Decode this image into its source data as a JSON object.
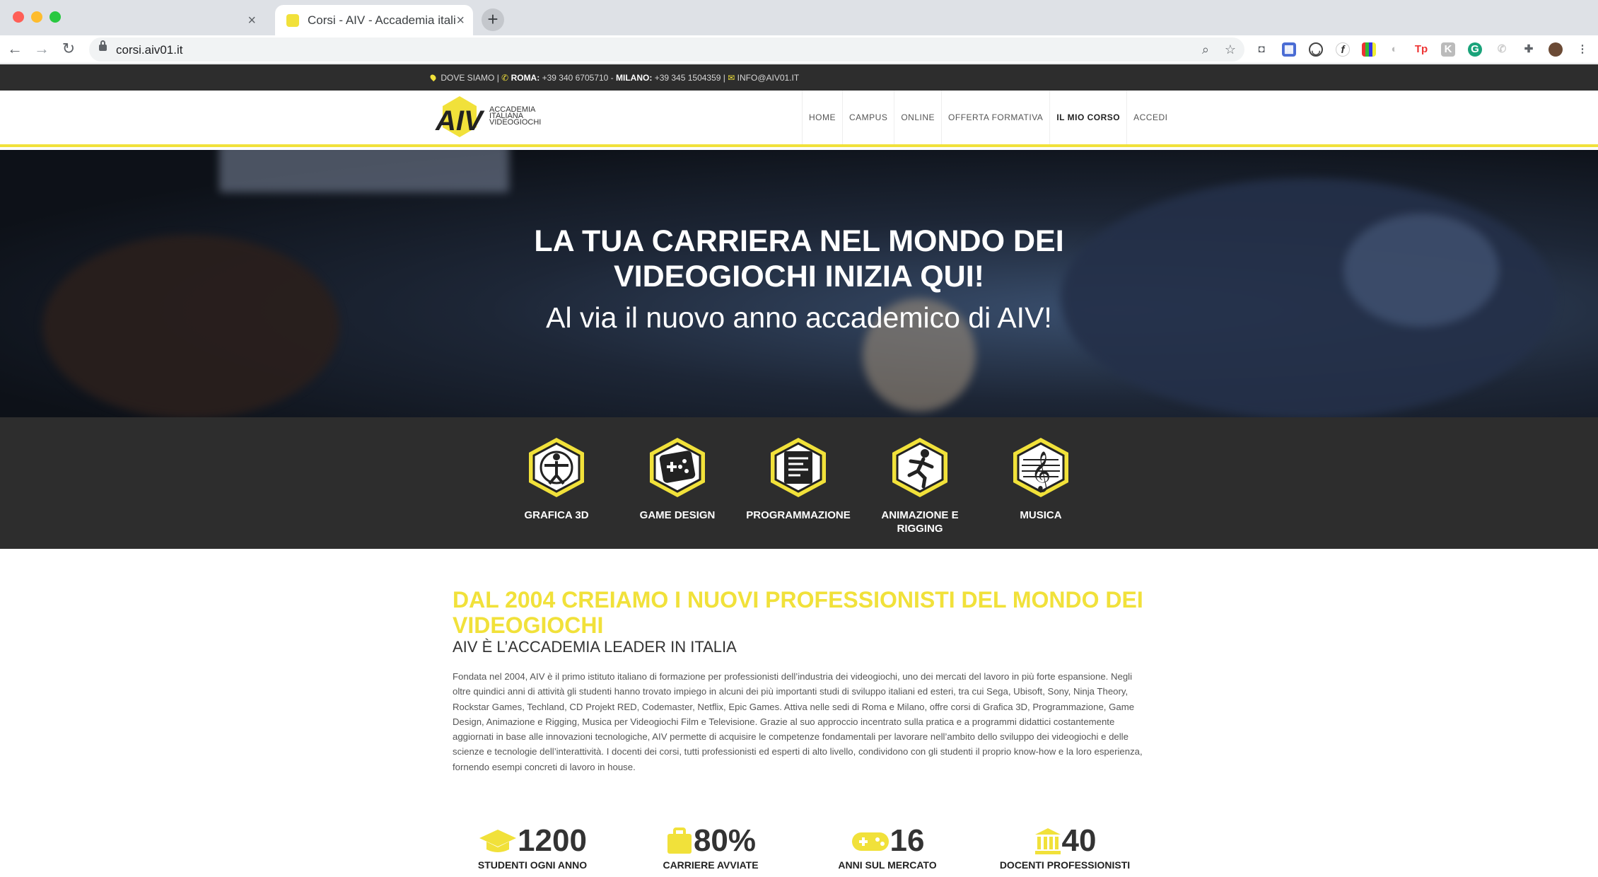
{
  "browser": {
    "tab_title": "Corsi - AIV - Accademia italiana videogiochi",
    "url": "corsi.aiv01.it"
  },
  "topbar": {
    "dove": "DOVE SIAMO",
    "roma_label": "ROMA:",
    "roma_phone": "+39 340 6705710",
    "milano_label": "MILANO:",
    "milano_phone": "+39 345 1504359",
    "email": "INFO@AIV01.IT"
  },
  "logo": {
    "lines": [
      "ACCADEMIA",
      "ITALIANA",
      "VIDEOGIOCHI"
    ]
  },
  "nav": [
    "HOME",
    "CAMPUS",
    "ONLINE",
    "OFFERTA FORMATIVA",
    "IL MIO CORSO",
    "ACCEDI"
  ],
  "hero": {
    "title_line1": "LA TUA CARRIERA NEL MONDO DEI",
    "title_line2": "VIDEOGIOCHI INIZIA QUI!",
    "subtitle": "Al via il nuovo anno accademico di AIV!"
  },
  "courses": [
    {
      "label": "GRAFICA 3D",
      "icon": "vitruvian-icon"
    },
    {
      "label": "GAME DESIGN",
      "icon": "dice-icon"
    },
    {
      "label": "PROGRAMMAZIONE",
      "icon": "code-sheet-icon"
    },
    {
      "label": "ANIMAZIONE E RIGGING",
      "icon": "running-figure-icon"
    },
    {
      "label": "MUSICA",
      "icon": "treble-clef-icon"
    }
  ],
  "content": {
    "headline": "DAL 2004 CREIAMO I NUOVI PROFESSIONISTI DEL MONDO DEI VIDEOGIOCHI",
    "subhead": "AIV È L’ACCADEMIA LEADER IN ITALIA",
    "body": "Fondata nel 2004, AIV è il primo istituto italiano di formazione per professionisti dell’industria dei videogiochi, uno dei mercati del lavoro in più forte espansione. Negli oltre quindici anni di attività gli studenti hanno trovato impiego in alcuni dei più importanti studi di sviluppo italiani ed esteri, tra cui Sega, Ubisoft, Sony, Ninja Theory, Rockstar Games, Techland, CD Projekt RED, Codemaster, Netflix, Epic Games. Attiva nelle sedi di Roma e Milano, offre corsi di Grafica 3D, Programmazione, Game Design, Animazione e Rigging, Musica per Videogiochi Film e Televisione. Grazie al suo approccio incentrato sulla pratica e a programmi didattici costantemente aggiornati in base alle innovazioni tecnologiche, AIV permette di acquisire le competenze fondamentali per lavorare nell’ambito dello sviluppo dei videogiochi e delle scienze e tecnologie dell’interattività. I docenti dei corsi, tutti professionisti ed esperti di alto livello, condividono con gli studenti il proprio know-how e la loro esperienza, fornendo esempi concreti di lavoro in house."
  },
  "stats": [
    {
      "value": "1200",
      "label": "STUDENTI OGNI ANNO",
      "icon": "graduation-cap-icon"
    },
    {
      "value": "80%",
      "label": "CARRIERE AVVIATE",
      "icon": "briefcase-icon"
    },
    {
      "value": "16",
      "label": "ANNI SUL MERCATO",
      "icon": "gamepad-icon"
    },
    {
      "value": "40",
      "label": "DOCENTI PROFESSIONISTI",
      "icon": "institution-icon"
    }
  ],
  "colors": {
    "accent": "#f1e13a",
    "dark": "#2d2d2d"
  }
}
